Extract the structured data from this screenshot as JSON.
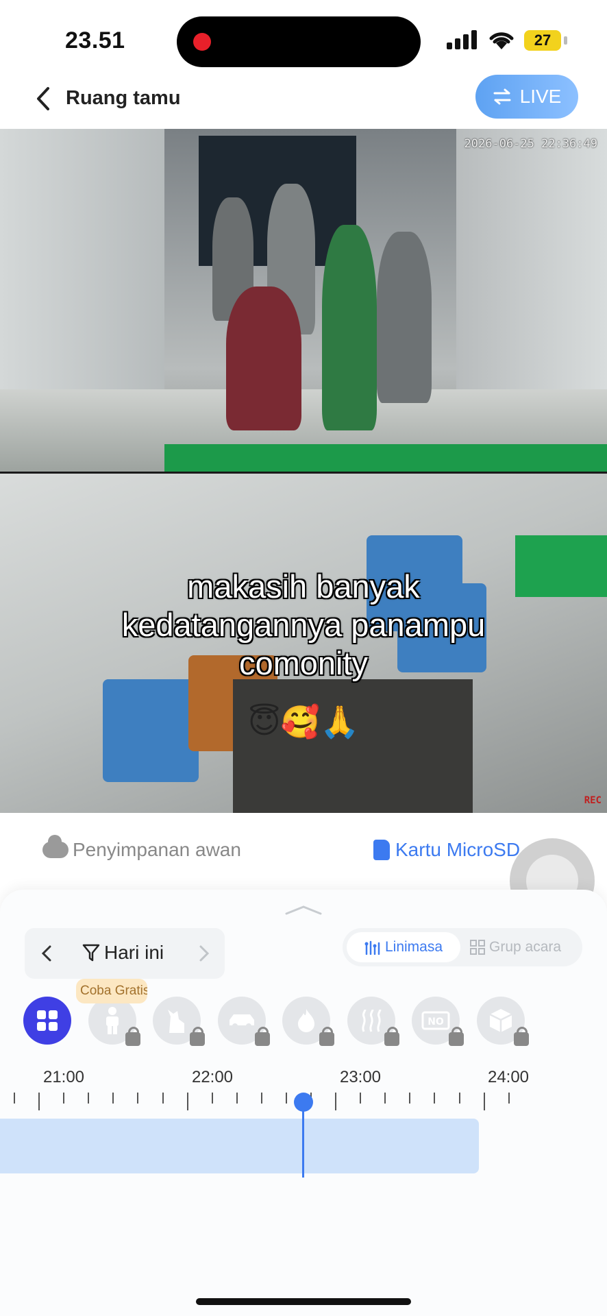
{
  "status_bar": {
    "time": "23.51",
    "battery": "27"
  },
  "header": {
    "title": "Ruang tamu",
    "live_label": "LIVE"
  },
  "video": {
    "timestamp": "2026-06-25 22:36:49",
    "rec_label": "REC",
    "caption_lines": [
      "makasih banyak",
      "kedatangannya panampu",
      "comonity"
    ],
    "emojis": "😇🥰🙏"
  },
  "storage": {
    "cloud_label": "Penyimpanan awan",
    "sd_label": "Kartu MicroSD"
  },
  "sheet": {
    "date_label": "Hari ini",
    "timeline_label": "Linimasa",
    "event_group_label": "Grup acara",
    "tooltip": "Coba Gratis"
  },
  "filters": [
    {
      "name": "all",
      "icon": "grid-icon",
      "locked": false,
      "active": true
    },
    {
      "name": "person",
      "icon": "person-icon",
      "locked": true
    },
    {
      "name": "pet",
      "icon": "pet-icon",
      "locked": true
    },
    {
      "name": "vehicle",
      "icon": "car-icon",
      "locked": true
    },
    {
      "name": "fire",
      "icon": "fire-icon",
      "locked": true
    },
    {
      "name": "smoke",
      "icon": "smoke-icon",
      "locked": true
    },
    {
      "name": "no-motor",
      "icon": "no-sign-icon",
      "locked": true
    },
    {
      "name": "package",
      "icon": "package-icon",
      "locked": true
    }
  ],
  "timeline": {
    "hours": [
      "21:00",
      "22:00",
      "23:00",
      "24:00"
    ],
    "playhead_time": "22:36"
  },
  "colors": {
    "accent": "#3c7af0",
    "active_filter": "#3f3fe4",
    "recording": "#cfe2fa"
  }
}
